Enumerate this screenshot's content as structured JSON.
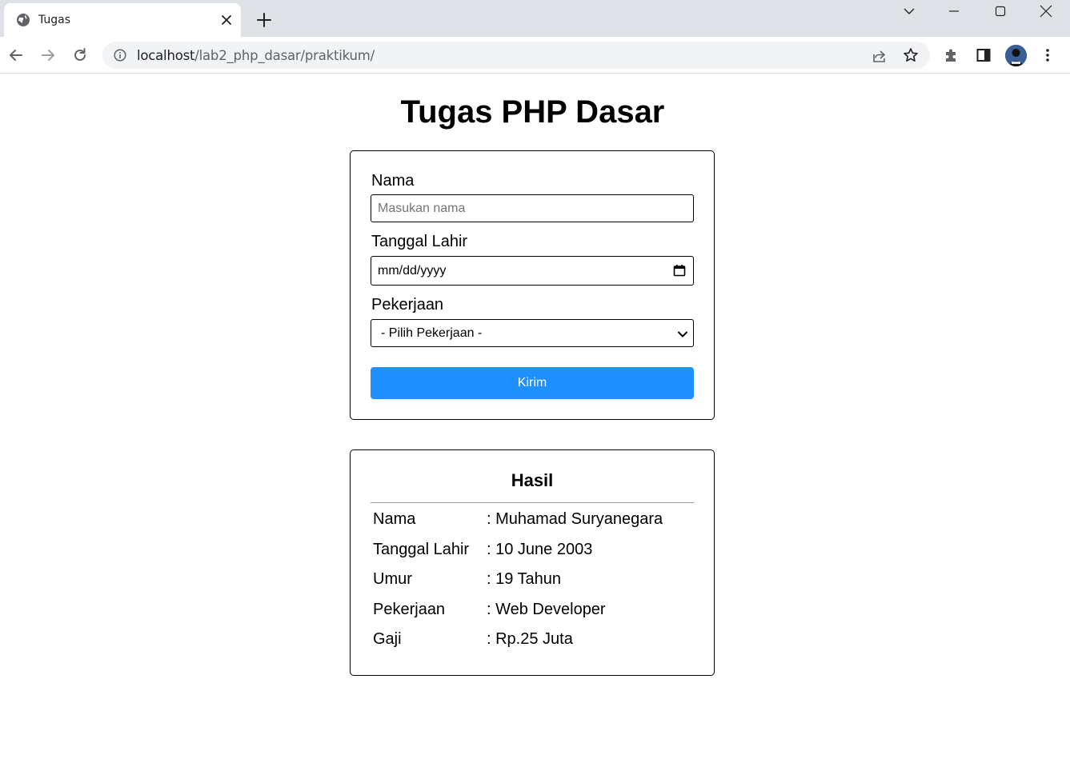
{
  "browser": {
    "tab_title": "Tugas",
    "url_host": "localhost",
    "url_path": "/lab2_php_dasar/praktikum/"
  },
  "page": {
    "title": "Tugas PHP Dasar"
  },
  "form": {
    "nama_label": "Nama",
    "nama_placeholder": "Masukan nama",
    "tanggal_label": "Tanggal Lahir",
    "tanggal_value": "mm/dd/yyyy",
    "pekerjaan_label": "Pekerjaan",
    "pekerjaan_selected": "- Pilih Pekerjaan -",
    "submit_label": "Kirim",
    "submit_color": "#1e90ff"
  },
  "result": {
    "title": "Hasil",
    "rows": [
      {
        "key": "Nama",
        "value": ": Muhamad Suryanegara"
      },
      {
        "key": "Tanggal Lahir",
        "value": ": 10 June 2003"
      },
      {
        "key": "Umur",
        "value": ": 19 Tahun"
      },
      {
        "key": "Pekerjaan",
        "value": ": Web Developer"
      },
      {
        "key": "Gaji",
        "value": ": Rp.25 Juta"
      }
    ]
  },
  "icons": {
    "tab_favicon": "globe-icon",
    "tab_close": "close-icon",
    "new_tab": "plus-icon",
    "back": "arrow-left-icon",
    "forward": "arrow-right-icon",
    "reload": "reload-icon",
    "site_info": "info-icon",
    "share": "share-icon",
    "bookmark": "star-icon",
    "extensions": "puzzle-icon",
    "side_panel": "side-panel-icon",
    "profile": "avatar",
    "menu": "kebab-menu-icon"
  }
}
